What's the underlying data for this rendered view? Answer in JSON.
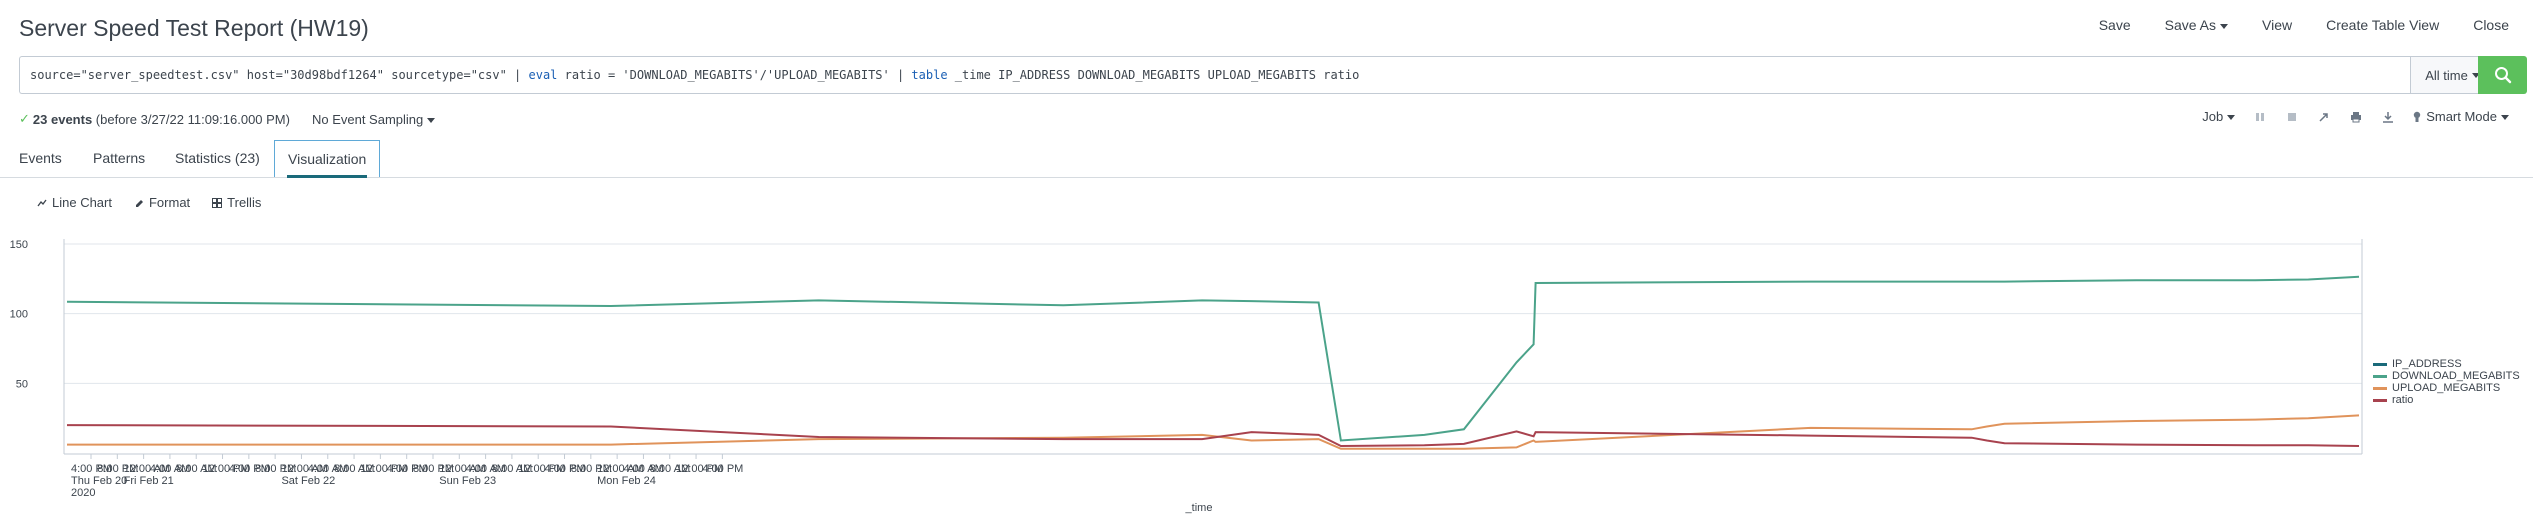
{
  "header": {
    "title": "Server Speed Test Report (HW19)",
    "nav": [
      "Save",
      "Save As",
      "View",
      "Create Table View",
      "Close"
    ]
  },
  "search": {
    "query_parts": [
      {
        "t": "source=\"server_speedtest.csv\" host=\"30d98bdf1264\" sourcetype=\"csv\" | ",
        "kw": false
      },
      {
        "t": "eval",
        "kw": true
      },
      {
        "t": " ratio = 'DOWNLOAD_MEGABITS'/'UPLOAD_MEGABITS' | ",
        "kw": false
      },
      {
        "t": "table",
        "kw": true
      },
      {
        "t": " _time IP_ADDRESS DOWNLOAD_MEGABITS UPLOAD_MEGABITS ratio",
        "kw": false
      }
    ],
    "time_range": "All time",
    "search_icon": "magnifier-icon"
  },
  "status": {
    "events": "23 events",
    "before": "(before 3/27/22 11:09:16.000 PM)",
    "sampling": "No Event Sampling",
    "job": "Job",
    "mode": "Smart Mode"
  },
  "tabs": [
    "Events",
    "Patterns",
    "Statistics (23)",
    "Visualization"
  ],
  "viz_toolbar": {
    "chart_type": "Line Chart",
    "format": "Format",
    "trellis": "Trellis"
  },
  "chart_data": {
    "type": "line",
    "xlabel": "_time",
    "ylim": [
      0,
      150
    ],
    "yticks": [
      50,
      100,
      150
    ],
    "xtick_labels": [
      [
        "4:00 PM",
        "Thu Feb 20",
        "2020"
      ],
      [
        "8:00 PM"
      ],
      [
        "12:00 AM",
        "Fri Feb 21"
      ],
      [
        "4:00 AM"
      ],
      [
        "8:00 AM"
      ],
      [
        "12:00 PM"
      ],
      [
        "4:00 PM"
      ],
      [
        "8:00 PM"
      ],
      [
        "12:00 AM",
        "Sat Feb 22"
      ],
      [
        "4:00 AM"
      ],
      [
        "8:00 AM"
      ],
      [
        "12:00 PM"
      ],
      [
        "4:00 PM"
      ],
      [
        "8:00 PM"
      ],
      [
        "12:00 AM",
        "Sun Feb 23"
      ],
      [
        "4:00 AM"
      ],
      [
        "8:00 AM"
      ],
      [
        "12:00 PM"
      ],
      [
        "4:00 PM"
      ],
      [
        "8:00 PM"
      ],
      [
        "12:00 AM",
        "Mon Feb 24"
      ],
      [
        "4:00 AM"
      ],
      [
        "8:00 AM"
      ],
      [
        "12:00 PM"
      ],
      [
        "4:00 PM"
      ]
    ],
    "x_hours": [
      0,
      82.7,
      114.3,
      151.5,
      172.6,
      180.1,
      190.3,
      193.7,
      206.4,
      212.4,
      220.4,
      223,
      223.3,
      265.1,
      289.6,
      291.9,
      294.6,
      314.6,
      332.7,
      340.8,
      348.5
    ],
    "series": [
      {
        "name": "IP_ADDRESS",
        "color": "#1a6a7a",
        "values": []
      },
      {
        "name": "DOWNLOAD_MEGABITS",
        "color": "#4ba38a",
        "values": [
          108.5,
          105.5,
          109.5,
          106,
          109.5,
          109,
          108,
          9,
          13,
          17,
          65,
          78,
          122,
          123,
          123,
          123,
          123,
          124,
          124,
          124.5,
          126.5
        ]
      },
      {
        "name": "UPLOAD_MEGABITS",
        "color": "#e0935b",
        "values": [
          6,
          6,
          10,
          11,
          13,
          9,
          10,
          3,
          3,
          3,
          4,
          9,
          8,
          18,
          17,
          19,
          21,
          23,
          24,
          25,
          27
        ]
      },
      {
        "name": "ratio",
        "color": "#a8424e",
        "values": [
          20,
          19,
          11.5,
          10,
          10,
          15,
          13,
          5,
          5.5,
          6.5,
          15.5,
          12,
          15,
          12.5,
          11,
          9,
          7,
          6,
          5.5,
          5.5,
          5
        ]
      }
    ]
  }
}
